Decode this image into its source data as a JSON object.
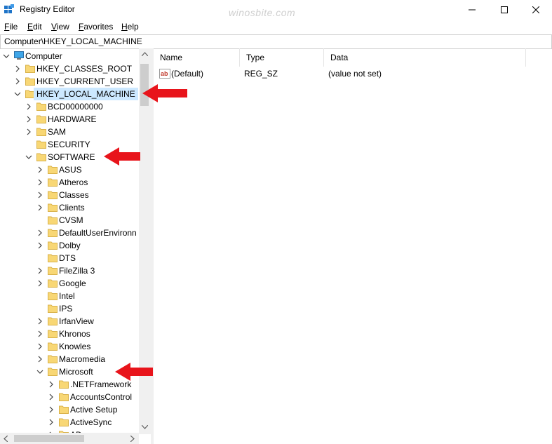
{
  "window": {
    "title": "Registry Editor",
    "watermark": "winosbite.com"
  },
  "menu": [
    {
      "label": "File",
      "accel": "F",
      "rest": "ile"
    },
    {
      "label": "Edit",
      "accel": "E",
      "rest": "dit"
    },
    {
      "label": "View",
      "accel": "V",
      "rest": "iew"
    },
    {
      "label": "Favorites",
      "accel": "F",
      "rest": "avorites"
    },
    {
      "label": "Help",
      "accel": "H",
      "rest": "elp"
    }
  ],
  "address": "Computer\\HKEY_LOCAL_MACHINE",
  "tree": {
    "root": "Computer",
    "hives": [
      "HKEY_CLASSES_ROOT",
      "HKEY_CURRENT_USER",
      "HKEY_LOCAL_MACHINE"
    ],
    "hklm_children": [
      "BCD00000000",
      "HARDWARE",
      "SAM",
      "SECURITY",
      "SOFTWARE"
    ],
    "software_children": [
      "ASUS",
      "Atheros",
      "Classes",
      "Clients",
      "CVSM",
      "DefaultUserEnvironn",
      "Dolby",
      "DTS",
      "FileZilla 3",
      "Google",
      "Intel",
      "IPS",
      "IrfanView",
      "Khronos",
      "Knowles",
      "Macromedia",
      "Microsoft"
    ],
    "microsoft_children": [
      ".NETFramework",
      "AccountsControl",
      "Active Setup",
      "ActiveSync",
      "AD"
    ]
  },
  "columns": {
    "name": "Name",
    "type": "Type",
    "data": "Data"
  },
  "values": [
    {
      "name": "(Default)",
      "type": "REG_SZ",
      "data": "(value not set)"
    }
  ],
  "colors": {
    "selection": "#cce8ff",
    "folder": "#f8d775",
    "arrow": "#e8141b"
  }
}
